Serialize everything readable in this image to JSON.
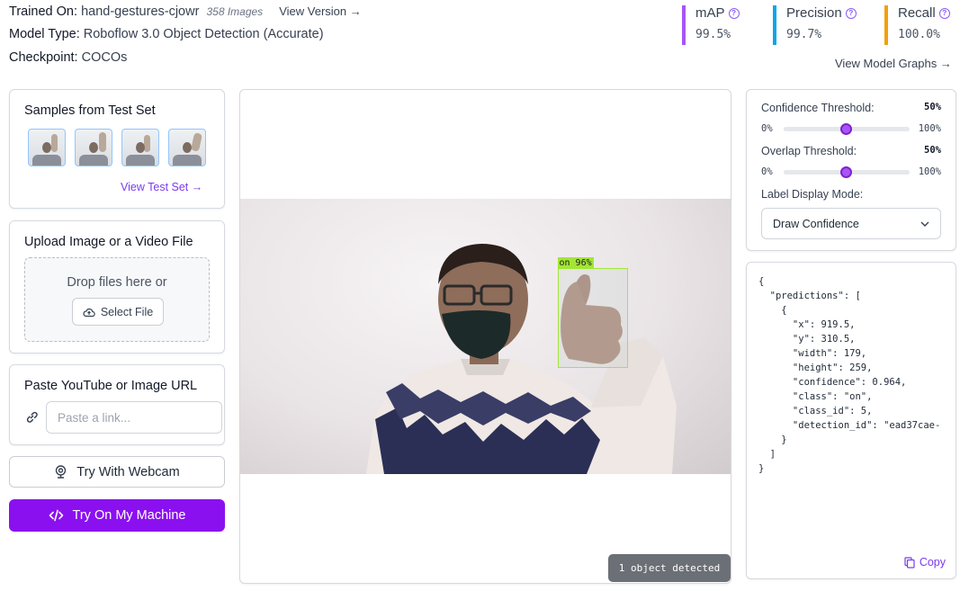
{
  "header": {
    "trained_on_label": "Trained On:",
    "trained_on_value": "hand-gestures-cjowr",
    "image_count": "358 Images",
    "view_version": "View Version →",
    "model_type_label": "Model Type:",
    "model_type_value": "Roboflow 3.0 Object Detection (Accurate)",
    "checkpoint_label": "Checkpoint:",
    "checkpoint_value": "COCOs"
  },
  "metrics": [
    {
      "name": "mAP",
      "value": "99.5%",
      "color": "#a855f7"
    },
    {
      "name": "Precision",
      "value": "99.7%",
      "color": "#0ea5e9"
    },
    {
      "name": "Recall",
      "value": "100.0%",
      "color": "#f59e0b"
    }
  ],
  "view_model_graphs": "View Model Graphs →",
  "samples": {
    "title": "Samples from Test Set",
    "thumbnails": [
      "thumbs-up-icon",
      "raised-hand-icon",
      "thumbs-up-icon",
      "waving-hand-icon"
    ],
    "view_link": "View Test Set →"
  },
  "upload": {
    "title": "Upload Image or a Video File",
    "drop_text": "Drop files here or",
    "select_button": "Select File"
  },
  "url": {
    "title": "Paste YouTube or Image URL",
    "placeholder": "Paste a link..."
  },
  "webcam_button": "Try With Webcam",
  "machine_button": "Try On My Machine",
  "detection": {
    "label": "on 96%",
    "status": "1 object detected"
  },
  "settings": {
    "confidence_label": "Confidence Threshold:",
    "confidence_value": "50%",
    "confidence_level": 0.5,
    "overlap_label": "Overlap Threshold:",
    "overlap_value": "50%",
    "overlap_level": 0.5,
    "min": "0%",
    "max": "100%",
    "label_mode_label": "Label Display Mode:",
    "label_mode_value": "Draw Confidence"
  },
  "json_output": [
    "{",
    "  \"predictions\": [",
    "    {",
    "      \"x\": 919.5,",
    "      \"y\": 310.5,",
    "      \"width\": 179,",
    "      \"height\": 259,",
    "      \"confidence\": 0.964,",
    "      \"class\": \"on\",",
    "      \"class_id\": 5,",
    "      \"detection_id\": \"ead37cae-",
    "    }",
    "  ]",
    "}"
  ],
  "copy_button": "Copy"
}
